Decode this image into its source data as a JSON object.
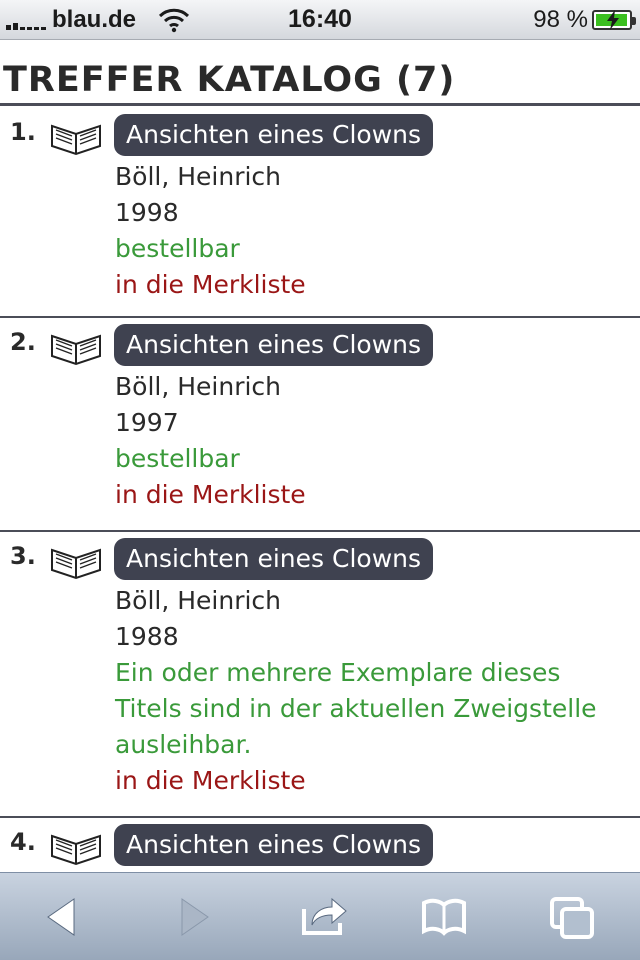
{
  "status_bar": {
    "carrier": "blau.de",
    "time": "16:40",
    "battery": "98 %",
    "battery_level": 0.98,
    "icons": [
      "signal-icon",
      "wifi-icon",
      "battery-icon"
    ]
  },
  "header": {
    "title": "TREFFER KATALOG (7)"
  },
  "results": [
    {
      "number": "1.",
      "title": "Ansichten eines Clowns",
      "author": "Böll, Heinrich",
      "year": "1998",
      "status": "bestellbar",
      "watchlist": "in die Merkliste"
    },
    {
      "number": "2.",
      "title": "Ansichten eines Clowns",
      "author": "Böll, Heinrich",
      "year": "1997",
      "status": "bestellbar",
      "watchlist": "in die Merkliste"
    },
    {
      "number": "3.",
      "title": "Ansichten eines Clowns",
      "author": "Böll, Heinrich",
      "year": "1988",
      "status": "Ein oder mehrere Exemplare dieses",
      "status2": "Titels sind in der aktuellen Zweigstelle",
      "status3": "ausleihbar.",
      "watchlist": "in die Merkliste"
    },
    {
      "number": "4.",
      "title": "Ansichten eines Clowns"
    }
  ],
  "toolbar": {
    "icons": [
      "back-icon",
      "forward-icon",
      "share-icon",
      "bookmarks-icon",
      "tabs-icon"
    ]
  },
  "colors": {
    "title_button": "#3f4250",
    "status_green": "#3a9a3a",
    "watchlist_red": "#9a1616",
    "divider": "#4b4d58"
  }
}
